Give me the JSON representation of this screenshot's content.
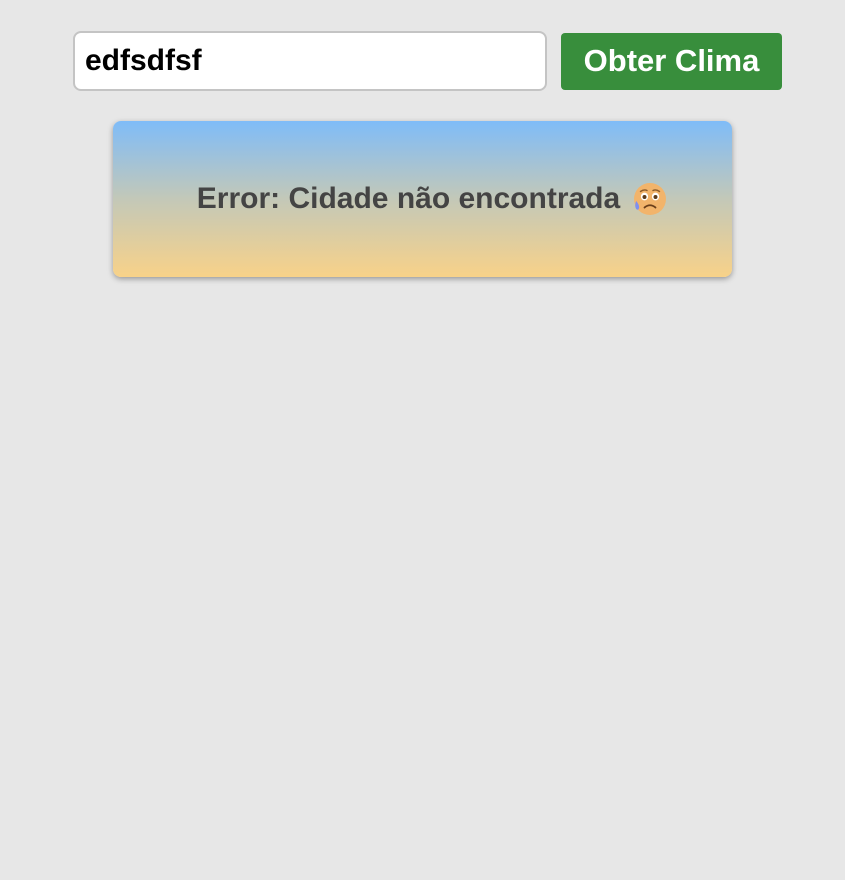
{
  "search": {
    "value": "edfsdfsf",
    "button_label": "Obter Clima"
  },
  "result": {
    "error_text": "Error: Cidade não encontrada",
    "icon": "sad-but-relieved-face-emoji"
  },
  "colors": {
    "background": "#e7e7e7",
    "button": "#388e3c",
    "card_gradient_top": "#7fbcf8",
    "card_gradient_bottom": "#f8d289",
    "error_text": "#444444"
  }
}
